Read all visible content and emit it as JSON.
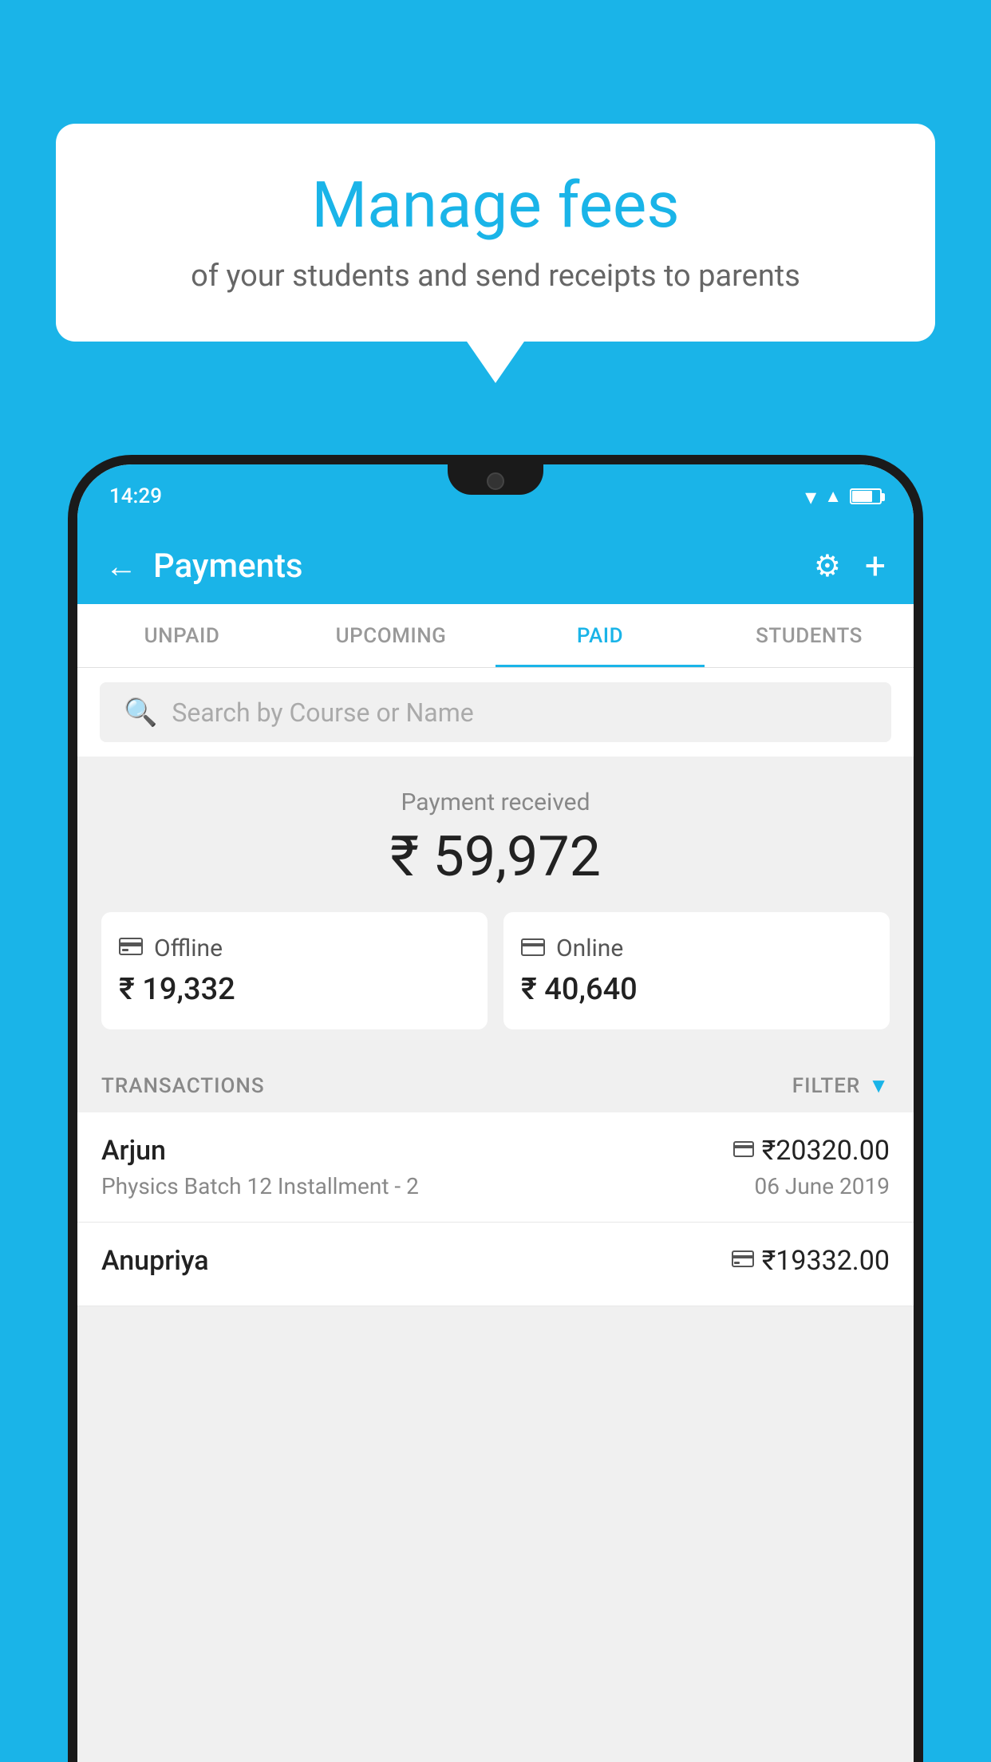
{
  "background_color": "#1ab4e8",
  "bubble": {
    "title": "Manage fees",
    "subtitle": "of your students and send receipts to parents"
  },
  "status_bar": {
    "time": "14:29"
  },
  "header": {
    "title": "Payments",
    "back_label": "←",
    "gear_label": "⚙",
    "plus_label": "+"
  },
  "tabs": [
    {
      "id": "unpaid",
      "label": "UNPAID",
      "active": false
    },
    {
      "id": "upcoming",
      "label": "UPCOMING",
      "active": false
    },
    {
      "id": "paid",
      "label": "PAID",
      "active": true
    },
    {
      "id": "students",
      "label": "STUDENTS",
      "active": false
    }
  ],
  "search": {
    "placeholder": "Search by Course or Name"
  },
  "payment": {
    "label": "Payment received",
    "amount": "₹ 59,972",
    "offline": {
      "icon": "💳",
      "type": "Offline",
      "amount": "₹ 19,332"
    },
    "online": {
      "icon": "💳",
      "type": "Online",
      "amount": "₹ 40,640"
    }
  },
  "transactions": {
    "label": "TRANSACTIONS",
    "filter_label": "FILTER",
    "rows": [
      {
        "name": "Arjun",
        "course": "Physics Batch 12 Installment - 2",
        "amount": "₹20320.00",
        "date": "06 June 2019",
        "payment_method": "card"
      },
      {
        "name": "Anupriya",
        "course": "",
        "amount": "₹19332.00",
        "date": "",
        "payment_method": "offline"
      }
    ]
  }
}
